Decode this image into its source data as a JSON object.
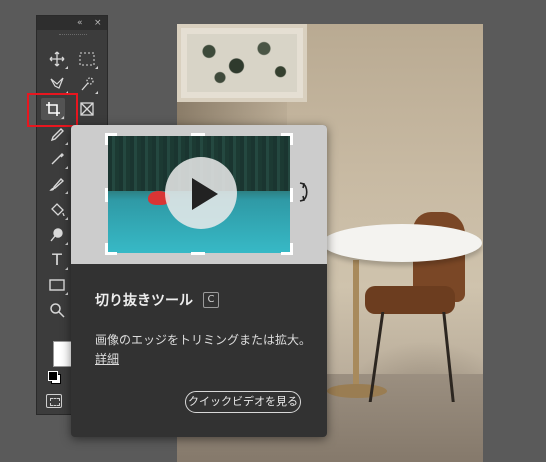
{
  "panel": {
    "collapse_label": "«",
    "close_label": "×"
  },
  "tooltip": {
    "title": "切り抜きツール",
    "shortcut": "C",
    "description": "画像のエッジをトリミングまたは拡大。",
    "details_link": "詳細",
    "video_button": "クイックビデオを見る"
  },
  "colors": {
    "highlight": "#e8161f",
    "panel_bg": "#3c3c3c",
    "card_bg": "#323232"
  }
}
